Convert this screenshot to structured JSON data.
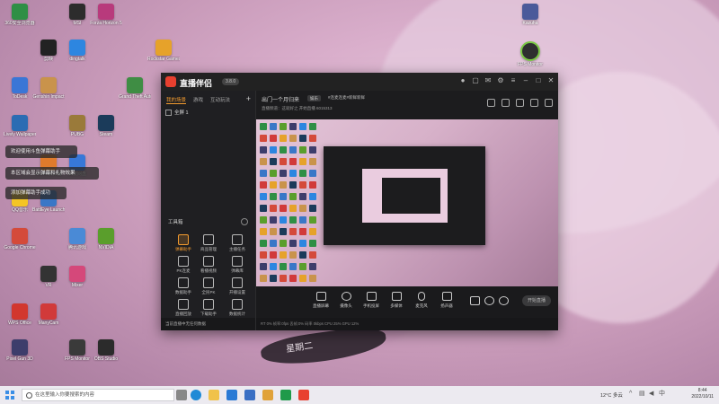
{
  "desktop_icons": [
    {
      "label": "360安全浏览器",
      "color": "#2f8f45"
    },
    {
      "label": "Lively Wallpaper",
      "color": "#2b6cb3"
    },
    {
      "label": "Google Chrome",
      "color": "#d44a3a"
    },
    {
      "label": "Pixel Gun 3D",
      "color": "#3d3d6b"
    },
    {
      "label": "Genshin Impact",
      "color": "#c9934b"
    },
    {
      "label": "BattlEye Launcher",
      "color": "#3a77c7"
    },
    {
      "label": "ManyCam",
      "color": "#d13a3a"
    },
    {
      "label": "dingtalk",
      "color": "#2d86e0"
    },
    {
      "label": "百度网盘",
      "color": "#3778d8"
    },
    {
      "label": "Mixer",
      "color": "#d5487a"
    },
    {
      "label": "Forza Horizon 5",
      "color": "#b83a7c"
    },
    {
      "label": "Steam",
      "color": "#1b3b5a"
    },
    {
      "label": "NVIDIA",
      "color": "#5a9e2c"
    },
    {
      "label": "OBS Studio",
      "color": "#2b2b2b"
    },
    {
      "label": "Grand Theft Auto V",
      "color": "#3f8d44"
    },
    {
      "label": "Rockstar Games",
      "color": "#e6a22a"
    },
    {
      "label": "ToDesk",
      "color": "#3a76d6"
    },
    {
      "label": "QQ音乐",
      "color": "#f4c525"
    },
    {
      "label": "WPS Office",
      "color": "#d2372e"
    },
    {
      "label": "剪映",
      "color": "#222222"
    },
    {
      "label": "MuMu模拟器",
      "color": "#e07b2c"
    },
    {
      "label": "VR",
      "color": "#333333"
    },
    {
      "label": "MSI",
      "color": "#2c2c2c"
    },
    {
      "label": "PUBG",
      "color": "#9a7a3a"
    },
    {
      "label": "腾讯游戏",
      "color": "#4a8ad6"
    },
    {
      "label": "FPS Monitor",
      "color": "#3a3a3a"
    }
  ],
  "right_icon": {
    "label": "Kazuha"
  },
  "right_icon2": {
    "label": "FPS Monitor"
  },
  "toasts": [
    "欢迎使用斗鱼弹幕助手",
    "本区域会显示弹幕和礼物效果",
    "添加弹幕助手成功"
  ],
  "app": {
    "title": "直播伴侣",
    "version": "3.8.0",
    "left_tabs": [
      "我的场景",
      "游戏",
      "互动玩法"
    ],
    "scene_name": "全屏 1",
    "toolbox_title": "工具箱",
    "tools": [
      {
        "label": "弹幕助手",
        "hot": true
      },
      {
        "label": "商品管理",
        "hot": false
      },
      {
        "label": "主播任务",
        "hot": false
      },
      {
        "label": "PK连麦",
        "hot": false
      },
      {
        "label": "看播视频",
        "hot": false
      },
      {
        "label": "弹幕库",
        "hot": false
      },
      {
        "label": "数据助手",
        "hot": false
      },
      {
        "label": "全民PK",
        "hot": false
      },
      {
        "label": "开播设置",
        "hot": false
      },
      {
        "label": "直播回放",
        "hot": false
      },
      {
        "label": "下载助手",
        "hot": false
      },
      {
        "label": "数据统计",
        "hot": false
      }
    ],
    "left_status": "当前直播中无任何数据",
    "stream_title": "出门一个月归来",
    "stream_tag": "娱乐",
    "stream_tag2": "#连麦连麦#新鲜新鲜",
    "stream_meta": "直播频道：这就好之  开始直播  6015313",
    "bottom_items": [
      "直播屏幕",
      "摄像头",
      "手机投屏",
      "多媒体",
      "麦克风",
      "扬声器"
    ],
    "go_live": "开始直播",
    "statusbar": "RT 0%   帧率:0fps   丢帧:0%   码率 0kbps   CPU 25%   GPU 12%"
  },
  "taskbar": {
    "search_placeholder": "在这里输入你要搜索的内容",
    "weather": "12°C 多云",
    "time": "8:44",
    "date": "2022/10/11"
  }
}
